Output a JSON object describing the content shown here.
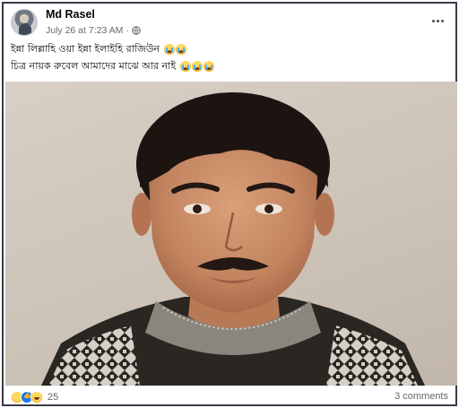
{
  "post": {
    "author": "Md Rasel",
    "timestamp": "July 26 at 7:23 AM",
    "audience_icon": "globe-icon",
    "caption_lines": [
      "ইন্না লিল্লাহি ওয়া ইন্না ইলাইহি রাজিউন",
      "চিত্র নায়ক রুবেল আমাদের মাঝে আর নাই"
    ],
    "emoji_line1": "crying-face-emoji ×2",
    "emoji_line2": "crying-face-emoji ×3"
  },
  "footer": {
    "reaction_icons": [
      "sad-reaction-icon",
      "like-reaction-icon",
      "haha-reaction-icon"
    ],
    "reaction_count": "25",
    "comments": "3 comments"
  },
  "colors": {
    "border": "#3a3a46",
    "text_primary": "#050505",
    "text_secondary": "#65676b",
    "like_blue": "#1877f2"
  }
}
